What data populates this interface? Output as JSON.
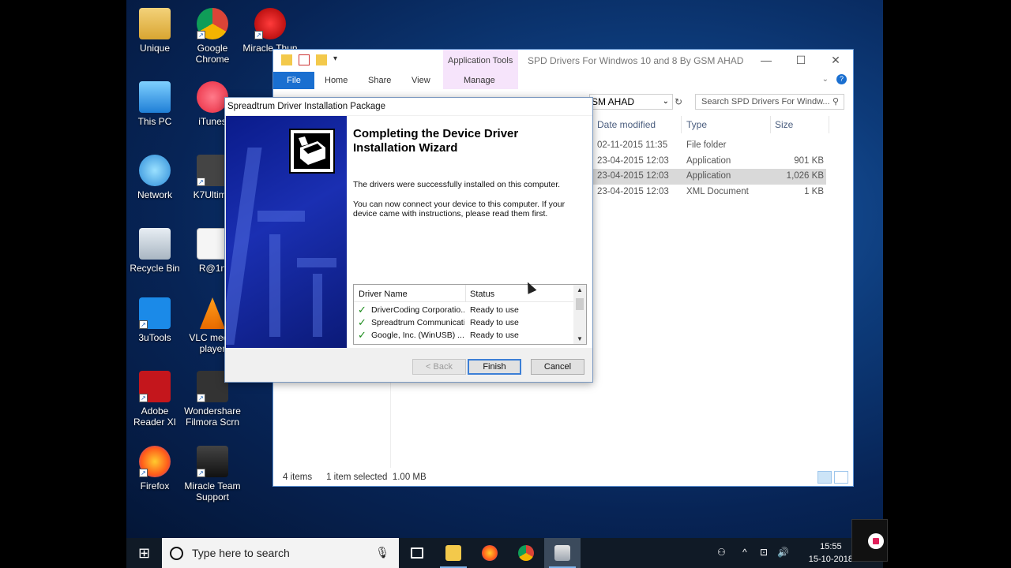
{
  "desktop_icons": [
    {
      "label": "Unique"
    },
    {
      "label": "Google Chrome"
    },
    {
      "label": "Miracle Thun"
    },
    {
      "label": "This PC"
    },
    {
      "label": "iTunes"
    },
    {
      "label": "Network"
    },
    {
      "label": "K7Ultima"
    },
    {
      "label": "Recycle Bin"
    },
    {
      "label": "R@1n"
    },
    {
      "label": "3uTools"
    },
    {
      "label": "VLC media player"
    },
    {
      "label": "Adobe Reader XI"
    },
    {
      "label": "Wondershare Filmora Scrn"
    },
    {
      "label": "Firefox"
    },
    {
      "label": "Miracle Team Support"
    }
  ],
  "explorer": {
    "title": "SPD Drivers For Windwos 10 and 8 By GSM AHAD",
    "context_tab_group": "Application Tools",
    "context_tab": "Manage",
    "tabs": {
      "file": "File",
      "home": "Home",
      "share": "Share",
      "view": "View"
    },
    "address": "SM AHAD",
    "search_placeholder": "Search SPD Drivers For Windw...",
    "columns": {
      "date": "Date modified",
      "type": "Type",
      "size": "Size"
    },
    "rows": [
      {
        "date": "02-11-2015 11:35",
        "type": "File folder",
        "size": ""
      },
      {
        "date": "23-04-2015 12:03",
        "type": "Application",
        "size": "901 KB"
      },
      {
        "date": "23-04-2015 12:03",
        "type": "Application",
        "size": "1,026 KB"
      },
      {
        "date": "23-04-2015 12:03",
        "type": "XML Document",
        "size": "1 KB"
      }
    ],
    "status": {
      "count": "4 items",
      "selection": "1 item selected",
      "size": "1.00 MB"
    }
  },
  "dialog": {
    "title": "Spreadtrum Driver Installation Package",
    "heading": "Completing the Device Driver Installation Wizard",
    "text1": "The drivers were successfully installed on this computer.",
    "text2": "You can now connect your device to this computer. If your device came with instructions, please read them first.",
    "list_headers": {
      "name": "Driver Name",
      "status": "Status"
    },
    "drivers": [
      {
        "name": "DriverCoding Corporatio...",
        "status": "Ready to use"
      },
      {
        "name": "Spreadtrum Communicati...",
        "status": "Ready to use"
      },
      {
        "name": "Google, Inc. (WinUSB) ...",
        "status": "Ready to use"
      }
    ],
    "buttons": {
      "back": "< Back",
      "finish": "Finish",
      "cancel": "Cancel"
    }
  },
  "taskbar": {
    "search_placeholder": "Type here to search",
    "time": "15:55",
    "date": "15-10-2018"
  }
}
